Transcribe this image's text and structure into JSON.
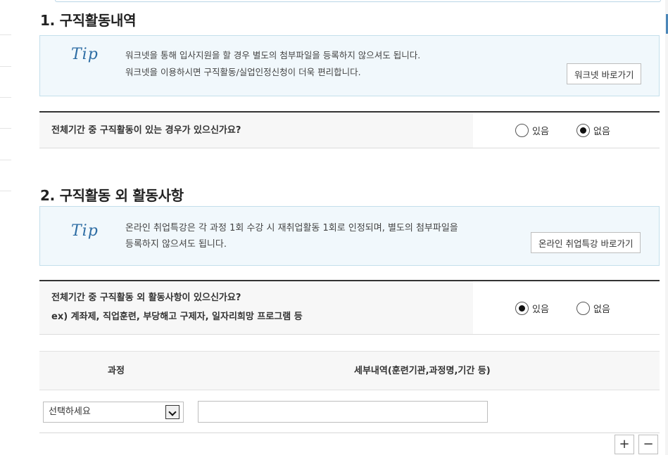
{
  "section1": {
    "title": "1. 구직활동내역",
    "tip": {
      "icon_text": "Tip",
      "line1": "워크넷을 통해 입사지원을 할 경우 별도의 첨부파일을 등록하지 않으셔도 됩니다.",
      "line2": "워크넷을 이용하시면 구직활동/실업인정신청이 더욱 편리합니다.",
      "button_label": "워크넷 바로가기"
    },
    "question": {
      "text": "전체기간 중 구직활동이 있는 경우가 있으신가요?",
      "options": [
        {
          "label": "있음",
          "selected": false
        },
        {
          "label": "없음",
          "selected": true
        }
      ]
    }
  },
  "section2": {
    "title": "2. 구직활동 외 활동사항",
    "tip": {
      "icon_text": "Tip",
      "line1": "온라인 취업특강은 각 과정 1회 수강 시 재취업활동 1회로 인정되며, 별도의 첨부파일을",
      "line2": "등록하지 않으셔도 됩니다.",
      "button_label": "온라인 취업특강 바로가기"
    },
    "question": {
      "text": "전체기간 중 구직활동 외 활동사항이 있으신가요?",
      "example": "ex) 계좌제, 직업훈련, 부당해고 구제자, 일자리희망 프로그램 등",
      "options": [
        {
          "label": "있음",
          "selected": true
        },
        {
          "label": "없음",
          "selected": false
        }
      ]
    },
    "table": {
      "headers": [
        "과정",
        "세부내역(훈련기관,과정명,기간 등)"
      ],
      "row": {
        "course_select": "선택하세요",
        "detail_value": ""
      }
    },
    "add_label": "+",
    "remove_label": "−"
  },
  "colors": {
    "accent": "#2e6da4",
    "tip_bg": "#f1f8fc",
    "tip_border": "#c4dfeb",
    "divider": "#333333"
  }
}
